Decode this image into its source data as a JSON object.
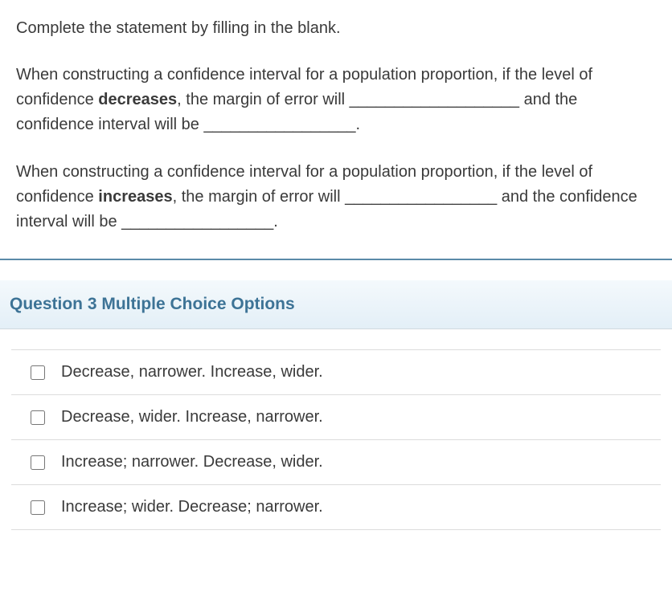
{
  "question": {
    "instruction": "Complete the statement by filling in the blank.",
    "para1_part1": "When constructing a confidence interval for a population proportion, if the level of confidence ",
    "para1_bold": "decreases",
    "para1_part2": ", the margin of error will ___________________ and the confidence interval will be _________________.",
    "para2_part1": "When constructing a confidence interval for a population proportion, if the level of confidence ",
    "para2_bold": "increases",
    "para2_part2": ", the margin of error will _________________ and the confidence interval will be _________________."
  },
  "options_header": "Question 3 Multiple Choice Options",
  "options": [
    {
      "label": "Decrease, narrower. Increase, wider."
    },
    {
      "label": "Decrease, wider. Increase, narrower."
    },
    {
      "label": "Increase; narrower. Decrease, wider."
    },
    {
      "label": "Increase; wider. Decrease; narrower."
    }
  ]
}
